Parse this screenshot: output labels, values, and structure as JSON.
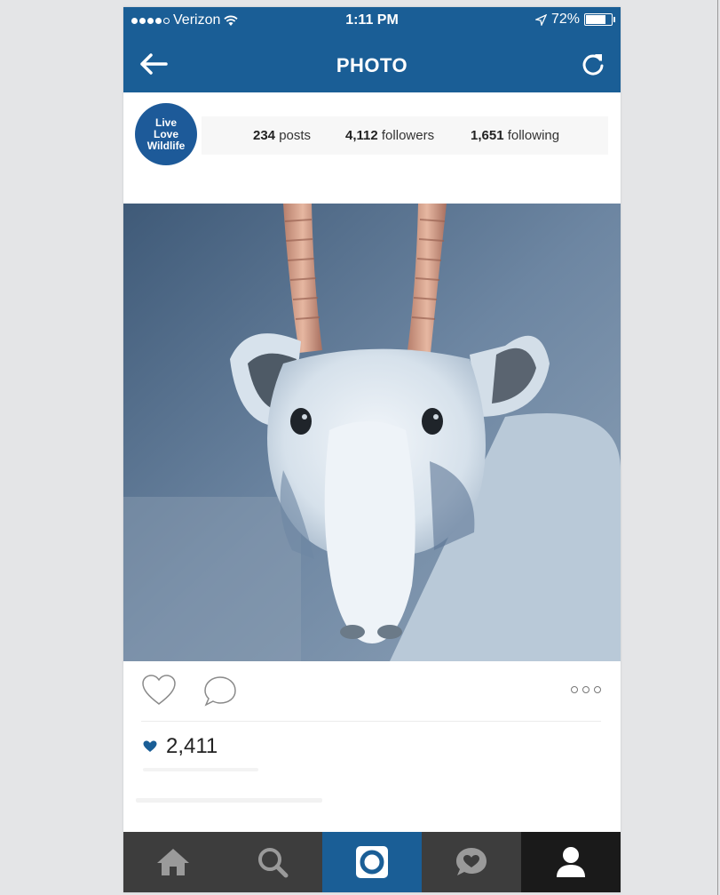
{
  "status_bar": {
    "carrier": "Verizon",
    "time": "1:11 PM",
    "battery": "72%",
    "battery_level": 0.72
  },
  "nav": {
    "title": "PHOTO",
    "back_icon": "back-arrow-icon",
    "refresh_icon": "refresh-icon"
  },
  "profile": {
    "avatar_lines": [
      "Live",
      "Love",
      "Wildlife"
    ],
    "posts_count": "234",
    "posts_label": "posts",
    "followers_count": "4,112",
    "followers_label": "followers",
    "following_count": "1,651",
    "following_label": "following"
  },
  "post": {
    "likes": "2,411"
  },
  "tabs": [
    {
      "name": "home",
      "icon": "home-icon"
    },
    {
      "name": "search",
      "icon": "search-icon"
    },
    {
      "name": "camera",
      "icon": "camera-icon",
      "active": true
    },
    {
      "name": "activity",
      "icon": "activity-icon"
    },
    {
      "name": "profile",
      "icon": "profile-icon"
    }
  ],
  "colors": {
    "brand_blue": "#1a5e96",
    "tab_bg": "#3d3d3d",
    "tab_dark": "#1a1a1a"
  }
}
